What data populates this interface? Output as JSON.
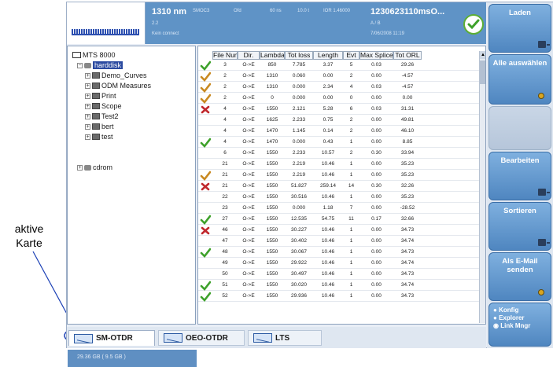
{
  "annotation": {
    "line1": "aktive",
    "line2": "Karte"
  },
  "header": {
    "wavelength": "1310 nm",
    "field_small_1": "SMOC3",
    "field_small_2": "Ofd",
    "field_small_3": "60 ns",
    "field_small_4": "10.0 t",
    "field_small_5": "IOR 1.46000",
    "sub1": "2.2",
    "sub2": "Kein connect",
    "filename": "1230623110msO...",
    "sub3": "A / B",
    "sub4": "7/06/2008  11:19",
    "status_icon": "check-icon"
  },
  "tree": {
    "root": "MTS 8000",
    "harddisk": "harddisk",
    "folders": [
      "Demo_Curves",
      "ODM Measures",
      "Print",
      "Scope",
      "Test2",
      "bert",
      "test"
    ],
    "cdrom": "cdrom",
    "status": "29.36 GB ( 9.5 GB )"
  },
  "table": {
    "columns": [
      "File Num",
      "Dir.",
      "Lambda",
      "Tot loss",
      "Length",
      "Evt",
      "Max Splice",
      "Tot ORL"
    ],
    "rows": [
      {
        "status": "ok",
        "num": "3",
        "dir": "O->E",
        "lambda": "850",
        "tot_loss": "7.785",
        "length": "3.37",
        "evt": "5",
        "max_splice": "0.03",
        "orl": "29.26"
      },
      {
        "status": "warn",
        "num": "2",
        "dir": "O->E",
        "lambda": "1310",
        "tot_loss": "0.060",
        "length": "0.00",
        "evt": "2",
        "max_splice": "0.00",
        "orl": "-4.57"
      },
      {
        "status": "warn",
        "num": "2",
        "dir": "O->E",
        "lambda": "1310",
        "tot_loss": "0.000",
        "length": "2.34",
        "evt": "4",
        "max_splice": "0.03",
        "orl": "-4.57"
      },
      {
        "status": "warn",
        "num": "2",
        "dir": "O->E",
        "lambda": "0",
        "tot_loss": "0.000",
        "length": "0.00",
        "evt": "0",
        "max_splice": "0.00",
        "orl": "0.00"
      },
      {
        "status": "fail",
        "num": "4",
        "dir": "O->E",
        "lambda": "1550",
        "tot_loss": "2.121",
        "length": "5.28",
        "evt": "6",
        "max_splice": "0.03",
        "orl": "31.31"
      },
      {
        "status": "none",
        "num": "4",
        "dir": "O->E",
        "lambda": "1625",
        "tot_loss": "2.233",
        "length": "0.75",
        "evt": "2",
        "max_splice": "0.00",
        "orl": "49.81"
      },
      {
        "status": "none",
        "num": "4",
        "dir": "O->E",
        "lambda": "1470",
        "tot_loss": "1.145",
        "length": "0.14",
        "evt": "2",
        "max_splice": "0.00",
        "orl": "46.10"
      },
      {
        "status": "ok",
        "num": "4",
        "dir": "O->E",
        "lambda": "1470",
        "tot_loss": "0.000",
        "length": "0.43",
        "evt": "1",
        "max_splice": "0.00",
        "orl": "8.85"
      },
      {
        "status": "none",
        "num": "6",
        "dir": "O->E",
        "lambda": "1550",
        "tot_loss": "2.233",
        "length": "10.57",
        "evt": "2",
        "max_splice": "0.30",
        "orl": "33.94"
      },
      {
        "status": "none",
        "num": "21",
        "dir": "O->E",
        "lambda": "1550",
        "tot_loss": "2.219",
        "length": "10.46",
        "evt": "1",
        "max_splice": "0.00",
        "orl": "35.23"
      },
      {
        "status": "warn",
        "num": "21",
        "dir": "O->E",
        "lambda": "1550",
        "tot_loss": "2.219",
        "length": "10.46",
        "evt": "1",
        "max_splice": "0.00",
        "orl": "35.23"
      },
      {
        "status": "fail",
        "num": "21",
        "dir": "O->E",
        "lambda": "1550",
        "tot_loss": "51.827",
        "length": "259.14",
        "evt": "14",
        "max_splice": "0.30",
        "orl": "32.26"
      },
      {
        "status": "none",
        "num": "22",
        "dir": "O->E",
        "lambda": "1550",
        "tot_loss": "30.516",
        "length": "10.46",
        "evt": "1",
        "max_splice": "0.00",
        "orl": "35.23"
      },
      {
        "status": "none",
        "num": "23",
        "dir": "O->E",
        "lambda": "1550",
        "tot_loss": "0.000",
        "length": "1.18",
        "evt": "7",
        "max_splice": "0.00",
        "orl": "-28.52"
      },
      {
        "status": "ok",
        "num": "27",
        "dir": "O->E",
        "lambda": "1550",
        "tot_loss": "12.535",
        "length": "54.75",
        "evt": "11",
        "max_splice": "0.17",
        "orl": "32.66"
      },
      {
        "status": "fail",
        "num": "46",
        "dir": "O->E",
        "lambda": "1550",
        "tot_loss": "30.227",
        "length": "10.46",
        "evt": "1",
        "max_splice": "0.00",
        "orl": "34.73"
      },
      {
        "status": "none",
        "num": "47",
        "dir": "O->E",
        "lambda": "1550",
        "tot_loss": "30.402",
        "length": "10.46",
        "evt": "1",
        "max_splice": "0.00",
        "orl": "34.74"
      },
      {
        "status": "ok",
        "num": "48",
        "dir": "O->E",
        "lambda": "1550",
        "tot_loss": "30.067",
        "length": "10.46",
        "evt": "1",
        "max_splice": "0.00",
        "orl": "34.73"
      },
      {
        "status": "none",
        "num": "49",
        "dir": "O->E",
        "lambda": "1550",
        "tot_loss": "29.922",
        "length": "10.46",
        "evt": "1",
        "max_splice": "0.00",
        "orl": "34.74"
      },
      {
        "status": "none",
        "num": "50",
        "dir": "O->E",
        "lambda": "1550",
        "tot_loss": "30.497",
        "length": "10.46",
        "evt": "1",
        "max_splice": "0.00",
        "orl": "34.73"
      },
      {
        "status": "ok",
        "num": "51",
        "dir": "O->E",
        "lambda": "1550",
        "tot_loss": "30.020",
        "length": "10.46",
        "evt": "1",
        "max_splice": "0.00",
        "orl": "34.74"
      },
      {
        "status": "ok",
        "num": "52",
        "dir": "O->E",
        "lambda": "1550",
        "tot_loss": "29.936",
        "length": "10.46",
        "evt": "1",
        "max_splice": "0.00",
        "orl": "34.73"
      }
    ]
  },
  "buttons": {
    "laden": "Laden",
    "alle": "Alle auswählen",
    "bearbeiten": "Bearbeiten",
    "sortieren": "Sortieren",
    "email": "Als E-Mail senden",
    "mode_options": [
      "Konfig",
      "Explorer",
      "Link Mngr"
    ]
  },
  "tabs": [
    "SM-OTDR",
    "OEO-OTDR",
    "LTS"
  ],
  "colors": {
    "header": "#5f93c6",
    "button": "#4f86c0",
    "ok": "#3ea12b",
    "warn": "#c98a22",
    "fail": "#c0282d"
  }
}
